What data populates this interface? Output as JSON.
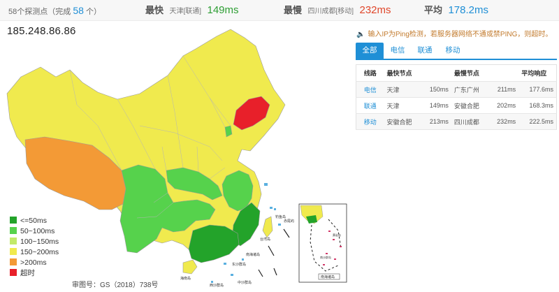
{
  "summary": {
    "probe_prefix": "58个探测点（完成",
    "probe_done": "58",
    "probe_suffix": "个）",
    "fastest_label": "最快",
    "fastest_location": "天津[联通]",
    "fastest_value": "149ms",
    "slowest_label": "最慢",
    "slowest_location": "四川成都[移动]",
    "slowest_value": "232ms",
    "average_label": "平均",
    "average_value": "178.2ms"
  },
  "ip": "185.248.86.86",
  "legend": [
    {
      "label": "<=50ms",
      "color": "#23a32a"
    },
    {
      "label": "50~100ms",
      "color": "#56d24c"
    },
    {
      "label": "100~150ms",
      "color": "#c2ea6a"
    },
    {
      "label": "150~200ms",
      "color": "#f0ea4e"
    },
    {
      "label": ">200ms",
      "color": "#f39a36"
    },
    {
      "label": "超时",
      "color": "#e8202a"
    }
  ],
  "approval": "审图号：GS（2018）738号",
  "map_labels": {
    "south_sea_islands": "南海诸岛",
    "taiwan": "台湾岛",
    "diaoyu": "钓鱼岛",
    "chiwei": "赤尾屿",
    "hainan": "海南岛",
    "huangyan": "黄岩岛",
    "nansha": "南沙群岛",
    "xisha": "西沙群岛",
    "zhongsha": "中沙群岛",
    "dongsha": "东沙群岛",
    "box_label": "南海诸岛"
  },
  "hint": "输入IP为Ping检测，若服务器网络不通或禁PING，则超时。",
  "tabs": [
    "全部",
    "电信",
    "联通",
    "移动"
  ],
  "table": {
    "headers": {
      "line": "线路",
      "fastest": "最快节点",
      "slowest": "最慢节点",
      "avg": "平均响应"
    },
    "rows": [
      {
        "line": "电信",
        "fast_node": "天津",
        "fast_ms": "150ms",
        "slow_node": "广东广州",
        "slow_ms": "211ms",
        "avg": "177.6ms"
      },
      {
        "line": "联通",
        "fast_node": "天津",
        "fast_ms": "149ms",
        "slow_node": "安徽合肥",
        "slow_ms": "202ms",
        "avg": "168.3ms"
      },
      {
        "line": "移动",
        "fast_node": "安徽合肥",
        "fast_ms": "213ms",
        "slow_node": "四川成都",
        "slow_ms": "232ms",
        "avg": "222.5ms"
      }
    ]
  },
  "colors": {
    "accent": "#1f8fd6",
    "fast": "#2e9e34",
    "slow": "#e0462a",
    "hint": "#c27a2c"
  }
}
